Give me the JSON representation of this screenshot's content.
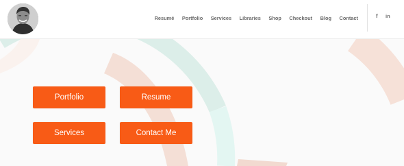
{
  "header": {
    "nav_items": [
      {
        "label": "Resumé"
      },
      {
        "label": "Portfolio"
      },
      {
        "label": "Services"
      },
      {
        "label": "Libraries"
      },
      {
        "label": "Shop"
      },
      {
        "label": "Checkout"
      },
      {
        "label": "Blog"
      },
      {
        "label": "Contact"
      }
    ],
    "social": {
      "facebook": "f",
      "linkedin": "in"
    }
  },
  "hero": {
    "buttons": {
      "portfolio": "Portfolio",
      "resume": "Resume",
      "services": "Services",
      "contact": "Contact Me"
    }
  },
  "colors": {
    "accent": "#f85b16",
    "background": "#fafafa",
    "arc_teal": "#d8ece8",
    "arc_peach": "#f3ddd3"
  }
}
